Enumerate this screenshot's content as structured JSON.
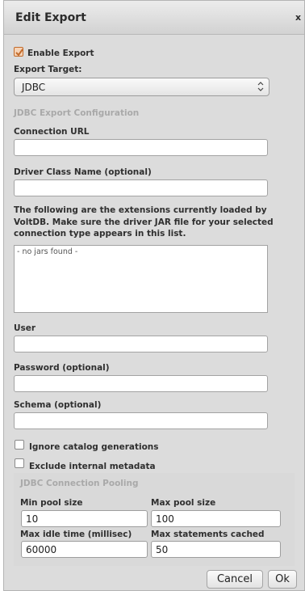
{
  "dialog": {
    "title": "Edit Export",
    "close_label": "x"
  },
  "enable_export": {
    "label": "Enable Export",
    "checked": true
  },
  "export_target": {
    "label": "Export Target:",
    "selected": "JDBC"
  },
  "jdbc_config": {
    "section_title": "JDBC Export Configuration",
    "connection_url_label": "Connection URL",
    "connection_url_value": "",
    "driver_class_label": "Driver Class Name (optional)",
    "driver_class_value": "",
    "extensions_note": "The following are the extensions currently loaded by VoltDB. Make sure the driver JAR file for your selected connection type appears in this list.",
    "jars_list_text": "- no jars found -",
    "user_label": "User",
    "user_value": "",
    "password_label": "Password (optional)",
    "password_value": "",
    "schema_label": "Schema (optional)",
    "schema_value": "",
    "ignore_generations_label": "Ignore catalog generations",
    "ignore_generations_checked": false,
    "exclude_metadata_label": "Exclude internal metadata",
    "exclude_metadata_checked": false
  },
  "pooling": {
    "section_title": "JDBC Connection Pooling",
    "min_pool_label": "Min pool size",
    "min_pool_value": "10",
    "max_pool_label": "Max pool size",
    "max_pool_value": "100",
    "max_idle_label": "Max idle time (millisec)",
    "max_idle_value": "60000",
    "max_statements_label": "Max statements cached",
    "max_statements_value": "50"
  },
  "footer": {
    "cancel_label": "Cancel",
    "ok_label": "Ok"
  },
  "colors": {
    "dialog_bg": "#dcdcdc",
    "section_gray": "#a9a9a9",
    "checkbox_accent": "#c26b2b"
  }
}
